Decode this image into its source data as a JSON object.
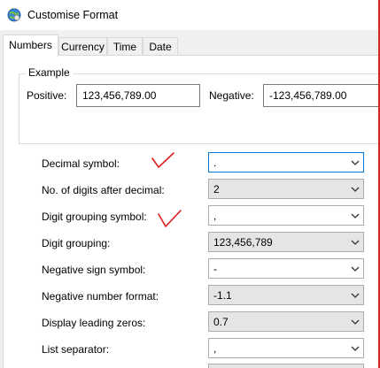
{
  "window": {
    "title": "Customise Format"
  },
  "tabs": [
    {
      "label": "Numbers",
      "active": true
    },
    {
      "label": "Currency",
      "active": false
    },
    {
      "label": "Time",
      "active": false
    },
    {
      "label": "Date",
      "active": false
    }
  ],
  "example": {
    "legend": "Example",
    "positive_label": "Positive:",
    "positive_value": "123,456,789.00",
    "negative_label": "Negative:",
    "negative_value": "-123,456,789.00"
  },
  "settings": [
    {
      "label": "Decimal symbol:",
      "value": ".",
      "focused": true
    },
    {
      "label": "No. of digits after decimal:",
      "value": "2"
    },
    {
      "label": "Digit grouping symbol:",
      "value": ",",
      "editable": true
    },
    {
      "label": "Digit grouping:",
      "value": "123,456,789"
    },
    {
      "label": "Negative sign symbol:",
      "value": "-",
      "editable": true
    },
    {
      "label": "Negative number format:",
      "value": "-1.1"
    },
    {
      "label": "Display leading zeros:",
      "value": "0.7"
    },
    {
      "label": "List separator:",
      "value": ",",
      "editable": true
    }
  ],
  "annotations": {
    "color": "#e02020",
    "icon": "red-checkmark-icon"
  },
  "colors": {
    "accent": "#0078d7",
    "border_highlight": "#d42727"
  }
}
